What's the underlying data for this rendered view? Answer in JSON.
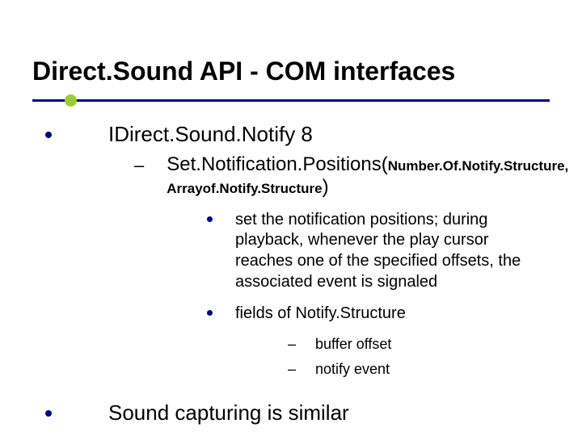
{
  "title": "Direct.Sound API - COM interfaces",
  "items": {
    "interface": "IDirect.Sound.Notify 8",
    "method": {
      "name": "Set.Notification.Positions(",
      "arg1": "Number.Of.Notify.Structure,",
      "arg2_prefix": "Arrayof.Notify.Structure",
      "close": ")"
    },
    "desc1": "set the notification positions; during playback, whenever the play cursor reaches one of the specified offsets, the associated event is signaled",
    "desc2": "fields of Notify.Structure",
    "fields": {
      "f1": "buffer offset",
      "f2": "notify event"
    },
    "closing": "Sound capturing is similar"
  }
}
